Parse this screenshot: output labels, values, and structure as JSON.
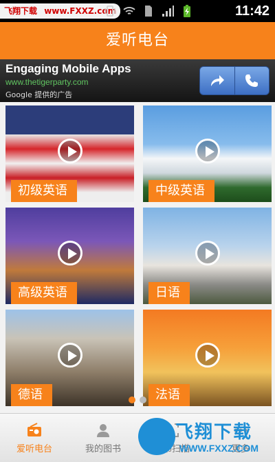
{
  "status_bar": {
    "watermark_site": "飞翔下载",
    "watermark_url": "www.FXXZ.com",
    "time": "11:42",
    "icons": [
      "image-icon",
      "android-icon",
      "vibrate-icon",
      "wifi-icon",
      "sim-icon",
      "signal-icon",
      "battery-charging-icon"
    ]
  },
  "app_bar": {
    "title": "爱听电台"
  },
  "ad": {
    "title": "Engaging Mobile Apps",
    "url": "www.thetigerparty.com",
    "note": "Google 提供的广告",
    "buttons": [
      "share-arrow-icon",
      "phone-icon"
    ]
  },
  "tiles": [
    {
      "label": "初级英语",
      "image": "statue-of-liberty"
    },
    {
      "label": "中级英语",
      "image": "white-house"
    },
    {
      "label": "高级英语",
      "image": "city-night"
    },
    {
      "label": "日语",
      "image": "japanese-castle"
    },
    {
      "label": "德语",
      "image": "cathedral"
    },
    {
      "label": "法语",
      "image": "eiffel-tower"
    }
  ],
  "pager": {
    "pages": 2,
    "current": 1
  },
  "tab_bar": {
    "items": [
      {
        "label": "爱听电台",
        "icon": "radio-icon",
        "active": true
      },
      {
        "label": "我的图书",
        "icon": "person-icon",
        "active": false
      },
      {
        "label": "图书扫描",
        "icon": "scan-icon",
        "active": false
      },
      {
        "label": "更多",
        "icon": "more-icon",
        "active": false
      }
    ]
  },
  "bottom_watermark": {
    "brand": "飞翔下载",
    "url": "WWW.FXXZ.COM"
  },
  "colors": {
    "accent": "#f7821b",
    "ad_bg": "#141414",
    "watermark_blue": "#1f8fd6"
  }
}
